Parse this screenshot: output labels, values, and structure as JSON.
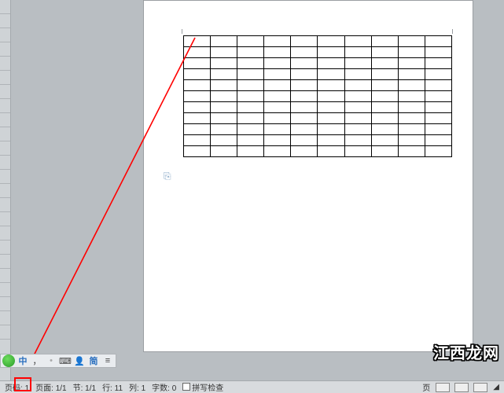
{
  "ime": {
    "lang": "中",
    "punct": "，",
    "bullet": "•",
    "keyboard_icon": "⌨",
    "user_icon": "👤",
    "simplified": "简",
    "menu_icon": "≡"
  },
  "status": {
    "page_label": "页码:",
    "page_value": "1",
    "page_count_label": "页面:",
    "page_count_value": "1/1",
    "section_label": "节:",
    "section_value": "1/1",
    "line_label": "行:",
    "line_value": "11",
    "col_label": "列:",
    "col_value": "1",
    "word_count_label": "字数:",
    "word_count_value": "0",
    "spellcheck": "拼写检查",
    "zoom_label": "页"
  },
  "table": {
    "rows": 11,
    "cols": 10
  },
  "watermark": "江西龙网"
}
